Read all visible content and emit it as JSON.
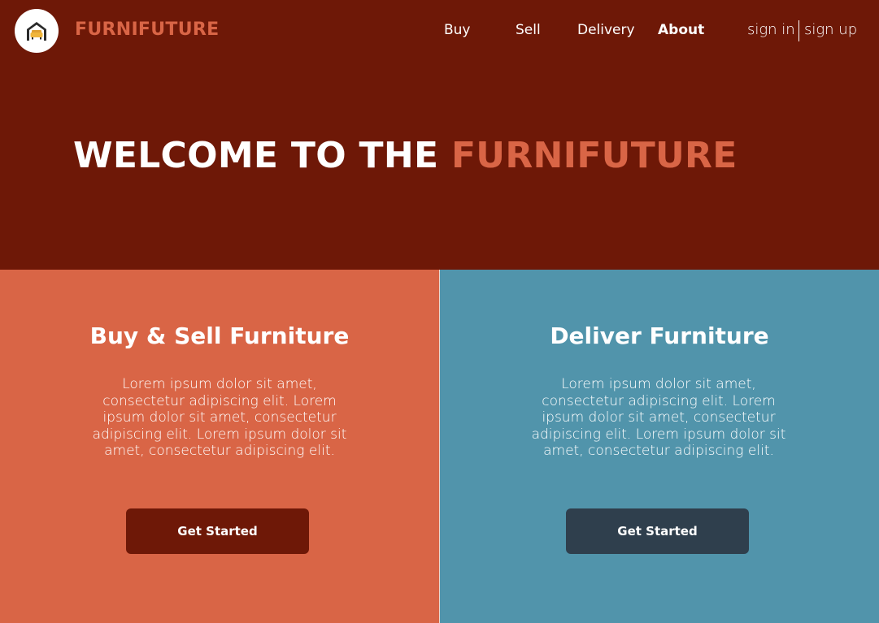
{
  "header": {
    "brand": "FURNIFUTURE",
    "logo_icon": "house-sofa-icon",
    "nav": [
      {
        "label": "Buy"
      },
      {
        "label": "Sell"
      },
      {
        "label": "Delivery"
      },
      {
        "label": "About",
        "active": true
      }
    ],
    "sign_in": "sign in",
    "sign_up": "sign up"
  },
  "hero": {
    "title_prefix": "WELCOME TO THE",
    "title_accent": "FURNIFUTURE"
  },
  "panels": [
    {
      "title": "Buy & Sell Furniture",
      "body": "Lorem ipsum dolor sit amet, consectetur adipiscing elit. Lorem ipsum dolor sit amet, consectetur adipiscing elit. Lorem ipsum dolor sit amet, consectetur adipiscing elit.",
      "button": "Get Started"
    },
    {
      "title": "Deliver Furniture",
      "body": "Lorem ipsum dolor sit amet, consectetur adipiscing elit. Lorem ipsum dolor sit amet, consectetur adipiscing elit. Lorem ipsum dolor sit amet, consectetur adipiscing elit.",
      "button": "Get Started"
    }
  ],
  "colors": {
    "hero_bg": "#6e1807",
    "accent": "#d96546",
    "delivery_bg": "#5194ab",
    "dark_button": "#2f3f4d"
  }
}
